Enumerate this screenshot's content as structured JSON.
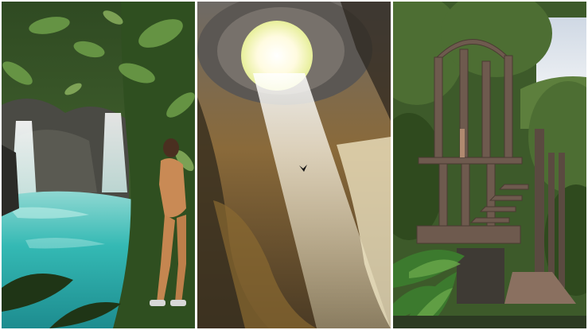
{
  "collage": {
    "panels": [
      {
        "subject": "waterfall-jungle-hiker",
        "palette": {
          "water": "#2fb5b5",
          "foliage": "#3f6b2a",
          "rock": "#4a4a44"
        }
      },
      {
        "subject": "sinkhole-cave-light-beam",
        "palette": {
          "rock": "#8a6a3a",
          "light": "#fffbe0",
          "shadow": "#2a241c"
        }
      },
      {
        "subject": "surreal-garden-stone-tower",
        "palette": {
          "sky": "#dfe6ee",
          "foliage": "#4d6e33",
          "structure": "#6e5a4e"
        }
      }
    ]
  }
}
